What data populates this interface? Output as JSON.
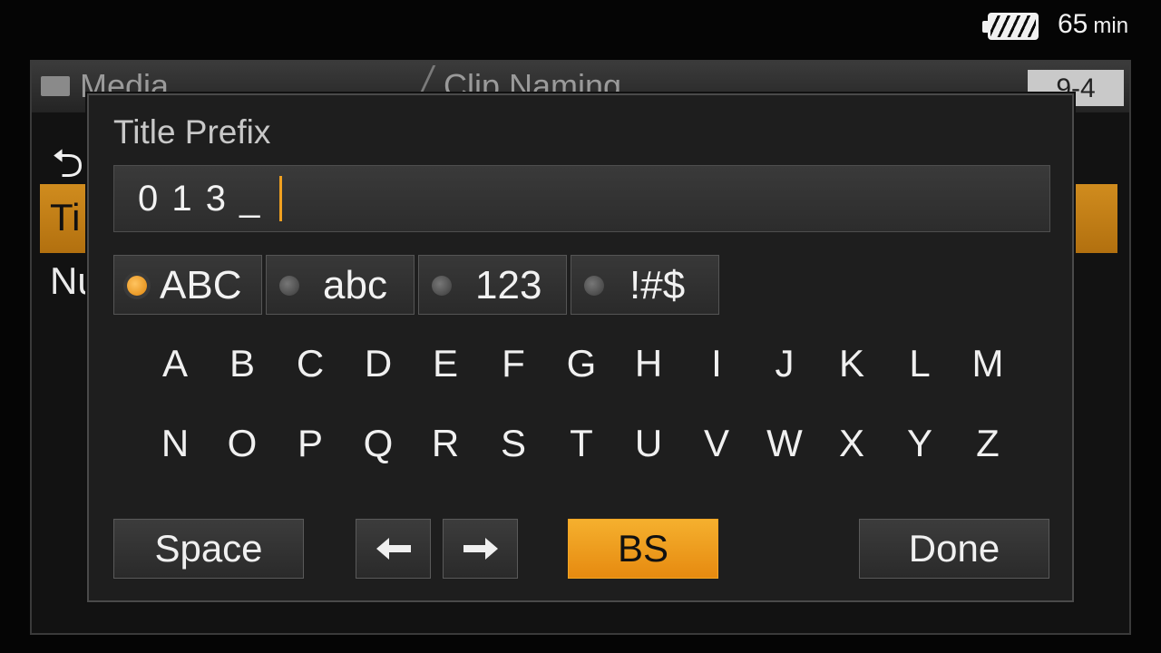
{
  "status": {
    "remaining_value": "65",
    "remaining_unit": "min",
    "battery_icon": "battery-full-icon"
  },
  "background_menu": {
    "media_label": "Media",
    "clip_label": "Clip Naming",
    "page": "9-4",
    "selected_row": "Ti",
    "row2": "Nu"
  },
  "dialog": {
    "title": "Title Prefix",
    "input_value": "0 1 3 _",
    "modes": [
      {
        "label": "ABC",
        "selected": true
      },
      {
        "label": "abc",
        "selected": false
      },
      {
        "label": "123",
        "selected": false
      },
      {
        "label": "!#$",
        "selected": false
      }
    ],
    "keys_row1": [
      "A",
      "B",
      "C",
      "D",
      "E",
      "F",
      "G",
      "H",
      "I",
      "J",
      "K",
      "L",
      "M"
    ],
    "keys_row2": [
      "N",
      "O",
      "P",
      "Q",
      "R",
      "S",
      "T",
      "U",
      "V",
      "W",
      "X",
      "Y",
      "Z"
    ],
    "space_label": "Space",
    "left_icon": "arrow-left-icon",
    "right_icon": "arrow-right-icon",
    "bs_label": "BS",
    "done_label": "Done"
  },
  "colors": {
    "accent": "#f0a020",
    "background": "#050505",
    "dialog": "#1e1e1e"
  }
}
